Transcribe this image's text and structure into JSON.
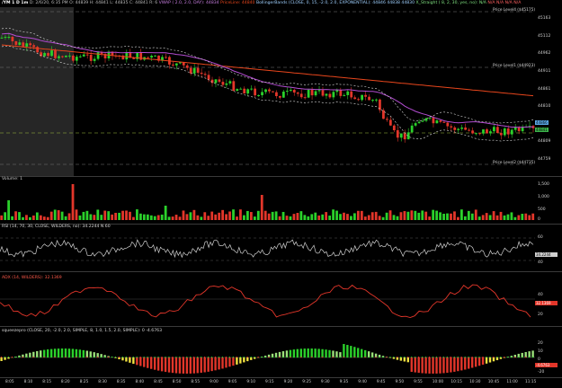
{
  "price_header": {
    "symbol": "/YM 1 D 1m",
    "ohlc": "D: 2/6/20, 6:35 PM  O: 44839  H: 44841  L: 44835  C: 44841  R: 6",
    "vwap": "VWAP ( 2.0, 2.0, DAY): 44834",
    "priceline": "PriceLine: 44840",
    "bollinger": "BollingerBands (CLOSE, 0, 15, -2.0, 2.0, EXPONENTIAL): 44846  44838  44830",
    "slope": "X_Straight ( 8, 2, 30, yes, no): N/A",
    "na_flags": [
      "N/A",
      "N/A",
      "N/A",
      "N/A"
    ]
  },
  "price_axis": {
    "ticks": [
      "45163",
      "45112",
      "44962",
      "44911",
      "44861",
      "44810",
      "44809",
      "44759"
    ],
    "flags": [
      {
        "value": "44866",
        "color": "#5aa8e8"
      },
      {
        "value": "44841",
        "color": "#3cb44b"
      }
    ]
  },
  "price_levels": [
    "Price Level4 ($45175)",
    "Price Level1 ($44923)",
    "Price Level2 ($44735)"
  ],
  "volume": {
    "header": "Volume: 1",
    "ticks": [
      "1,500",
      "1,000",
      "500",
      "0"
    ]
  },
  "rsi": {
    "header": "RSI (14, 70, 30, CLOSE, WILDERS, no): 34.2244  N  60",
    "ticks": [
      "60",
      "34.2244",
      "40"
    ],
    "flag": "34.2244"
  },
  "adx": {
    "header": "ADX (14, WILDERS): 32.1369",
    "ticks": [
      "40",
      "32.1369",
      "20"
    ],
    "flag": "32.1369"
  },
  "squeeze": {
    "header": "squeezepro (CLOSE, 20, -2.0, 2.0, SIMPLE, 8, 1.0, 1.5, 2.0, SIMPLE): 0  -4.6763",
    "ticks": [
      "20",
      "10",
      "0",
      "-4.6763",
      "-20"
    ]
  },
  "time_axis": [
    "8:05",
    "8:10",
    "8:15",
    "8:20",
    "8:25",
    "8:30",
    "8:35",
    "8:40",
    "8:45",
    "8:50",
    "8:55",
    "9:00",
    "9:05",
    "9:10",
    "9:15",
    "9:20",
    "9:25",
    "9:30",
    "9:35",
    "9:40",
    "9:45",
    "9:50",
    "9:55",
    "10:00",
    "10:15",
    "10:30",
    "10:45",
    "11:00",
    "11:15"
  ],
  "colors": {
    "up_candle": "#2bd12b",
    "down_candle": "#e3362a",
    "vwap_line": "#b34dd1",
    "ema_line": "#e8461c",
    "bands": "#dcdcdc",
    "premarket_shade": "#2b2b2b"
  }
}
